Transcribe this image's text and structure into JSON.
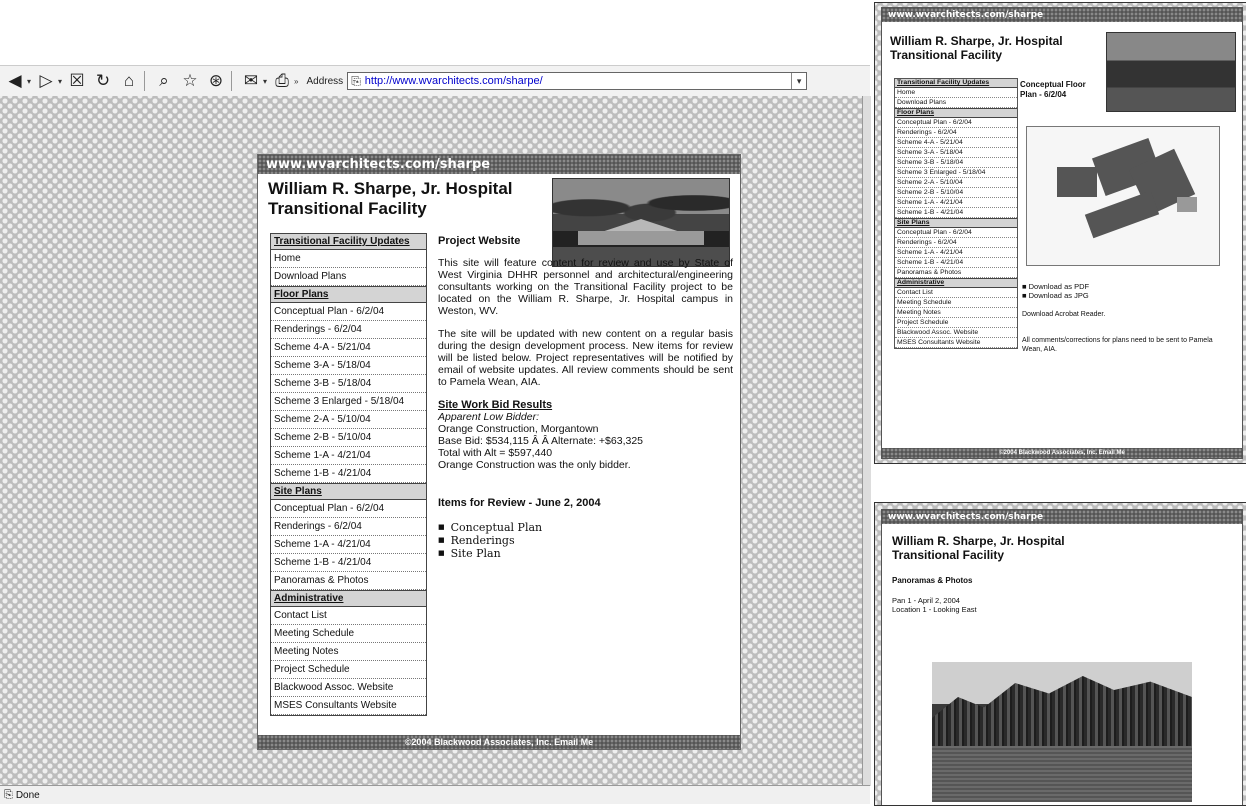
{
  "browser": {
    "address_label": "Address",
    "url": "http://www.wvarchitects.com/sharpe/",
    "more": "»",
    "status": "Done"
  },
  "site": {
    "bar_title": "www.wvarchitects.com/sharpe",
    "title_line1": "William R. Sharpe, Jr. Hospital",
    "title_line2": "Transitional Facility",
    "footer": "©2004 Blackwood Associates, Inc. Email Me"
  },
  "nav": {
    "sections": [
      {
        "heading": "Transitional Facility Updates",
        "items": [
          "Home",
          "Download Plans"
        ]
      },
      {
        "heading": "Floor Plans",
        "items": [
          "Conceptual Plan - 6/2/04",
          "Renderings - 6/2/04",
          "Scheme 4-A - 5/21/04",
          "Scheme 3-A - 5/18/04",
          "Scheme 3-B - 5/18/04",
          "Scheme 3 Enlarged - 5/18/04",
          "Scheme 2-A - 5/10/04",
          "Scheme 2-B - 5/10/04",
          "Scheme 1-A - 4/21/04",
          "Scheme 1-B - 4/21/04"
        ]
      },
      {
        "heading": "Site Plans",
        "items": [
          "Conceptual Plan - 6/2/04",
          "Renderings - 6/2/04",
          "Scheme 1-A - 4/21/04",
          "Scheme 1-B - 4/21/04",
          "Panoramas & Photos"
        ]
      },
      {
        "heading": "Administrative",
        "items": [
          "Contact List",
          "Meeting Schedule",
          "Meeting Notes",
          "Project Schedule",
          "Blackwood Assoc. Website",
          "MSES Consultants Website"
        ]
      }
    ]
  },
  "content": {
    "heading": "Project Website",
    "para1": "This site will feature content for review and use by State of West Virginia DHHR personnel and architectural/engineering consultants working on the Transitional Facility project to be located on the William R. Sharpe, Jr. Hospital campus in Weston, WV.",
    "para2": "The site will be updated with new content on a regular basis during the design development process. New items for review will be listed below. Project representatives will be notified by email of website updates. All review comments should be sent to Pamela Wean, AIA.",
    "bid_title": "Site Work Bid Results",
    "bid_sub": "Apparent Low Bidder:",
    "bid_line1": "Orange Construction, Morgantown",
    "bid_line2": "Base Bid: $534,115 Â Â Alternate: +$63,325",
    "bid_line3": "Total with Alt = $597,440",
    "bid_line4": "Orange Construction was the only bidder.",
    "items_title": "Items for Review - June 2, 2004",
    "items": [
      "Conceptual Plan",
      "Renderings",
      "Site Plan"
    ]
  },
  "window2": {
    "bar_title": "www.wvarchitects.com/sharpe",
    "title_line1": "William R. Sharpe, Jr. Hospital",
    "title_line2": "Transitional Facility",
    "subtitle_line1": "Conceptual Floor",
    "subtitle_line2": "Plan - 6/2/04",
    "download_pdf": "Download as PDF",
    "download_jpg": "Download as JPG",
    "acrobat": "Download Acrobat Reader.",
    "note": "All comments/corrections for plans need to be sent to Pamela Wean, AIA.",
    "footer": "©2004 Blackwood Associates, Inc. Email Me"
  },
  "window3": {
    "bar_title": "www.wvarchitects.com/sharpe",
    "title_line1": "William R. Sharpe, Jr. Hospital",
    "title_line2": "Transitional Facility",
    "subtitle": "Panoramas & Photos",
    "pan_line1": "Pan 1 - April 2, 2004",
    "pan_line2": "Location 1 - Looking East"
  }
}
